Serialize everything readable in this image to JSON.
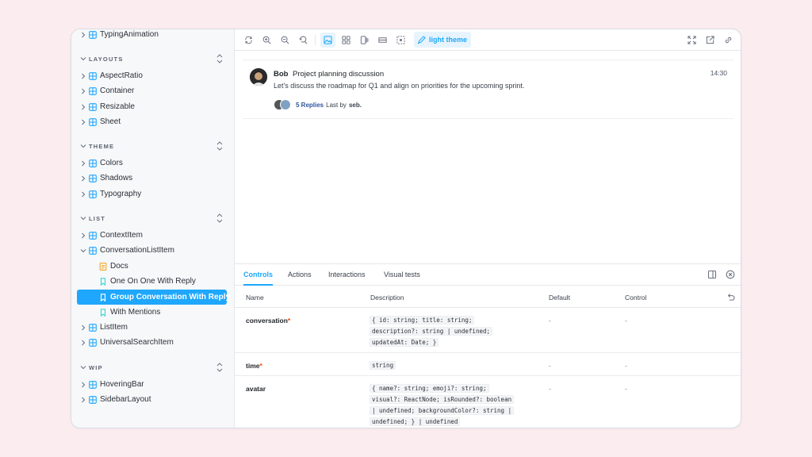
{
  "sidebar": {
    "top_item": "TypingAnimation",
    "sections": [
      {
        "label": "LAYOUTS",
        "items": [
          "AspectRatio",
          "Container",
          "Resizable",
          "Sheet"
        ]
      },
      {
        "label": "THEME",
        "items": [
          "Colors",
          "Shadows",
          "Typography"
        ]
      },
      {
        "label": "LIST",
        "items": [
          "ContextItem",
          "ConversationListItem",
          "ListItem",
          "UniversalSearchItem"
        ]
      },
      {
        "label": "WIP",
        "items": [
          "HoveringBar",
          "SidebarLayout"
        ]
      }
    ],
    "expanded_children": [
      "Docs",
      "One On One With Reply",
      "Group Conversation With Reply",
      "With Mentions"
    ],
    "selected": "Group Conversation With Reply"
  },
  "toolbar": {
    "theme_label": "light theme"
  },
  "preview": {
    "author": "Bob",
    "title": "Project planning discussion",
    "time": "14:30",
    "description": "Let's discuss the roadmap for Q1 and align on priorities for the upcoming sprint.",
    "replies_count": "5 Replies",
    "last_by_label": "Last by",
    "last_by_user": "seb."
  },
  "addons": {
    "tabs": [
      "Controls",
      "Actions",
      "Interactions",
      "Visual tests"
    ],
    "active_tab": "Controls",
    "columns": [
      "Name",
      "Description",
      "Default",
      "Control"
    ],
    "rows": [
      {
        "name": "conversation",
        "required": "*",
        "desc": [
          "{ id: string; title: string;",
          "description?: string | undefined;",
          "updatedAt: Date; }"
        ],
        "default": "-",
        "control": "-"
      },
      {
        "name": "time",
        "required": "*",
        "desc": [
          "string"
        ],
        "default": "-",
        "control": "-"
      },
      {
        "name": "avatar",
        "required": "",
        "desc": [
          "{ name?: string; emoji?: string;",
          "visual?: ReactNode; isRounded?: boolean",
          "| undefined; backgroundColor?: string |",
          "undefined; } | undefined"
        ],
        "default": "-",
        "control": "-"
      }
    ]
  },
  "colors": {
    "accent": "#1ea7fd",
    "required": "#ff4400",
    "background": "#fbecf0"
  }
}
